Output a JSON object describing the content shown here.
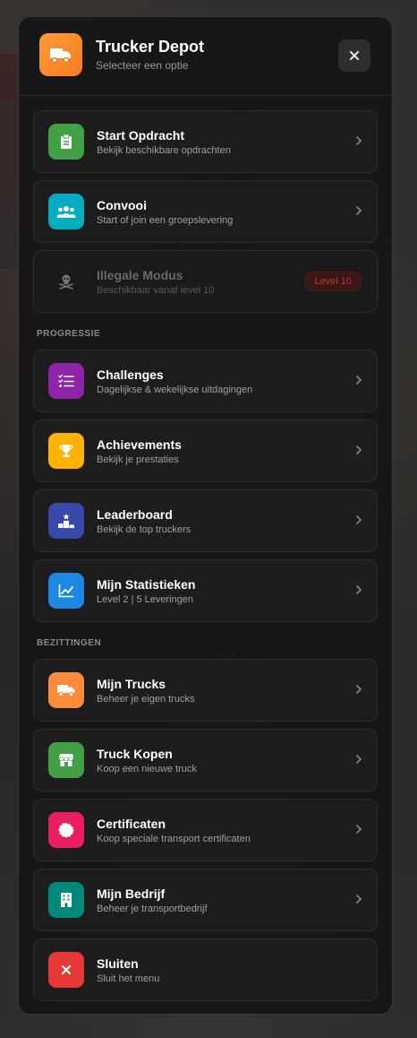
{
  "header": {
    "title": "Trucker Depot",
    "subtitle": "Selecteer een optie",
    "logo_icon": "truck-icon",
    "close_icon": "close-icon"
  },
  "items_main": [
    {
      "title": "Start Opdracht",
      "subtitle": "Bekijk beschikbare opdrachten",
      "icon": "clipboard-icon",
      "color": "#43a047"
    },
    {
      "title": "Convooi",
      "subtitle": "Start of join een groepslevering",
      "icon": "group-icon",
      "color": "#00acc1"
    },
    {
      "title": "Illegale Modus",
      "subtitle": "Beschikbaar vanaf level 10",
      "icon": "skull-icon",
      "badge": "Level 10"
    }
  ],
  "sections": {
    "progressie": "PROGRESSIE",
    "bezittingen": "BEZITTINGEN"
  },
  "items_progressie": [
    {
      "title": "Challenges",
      "subtitle": "Dagelijkse & wekelijkse uitdagingen",
      "icon": "checklist-icon",
      "color": "#8e24aa"
    },
    {
      "title": "Achievements",
      "subtitle": "Bekijk je prestaties",
      "icon": "trophy-icon",
      "color": "#ffb300"
    },
    {
      "title": "Leaderboard",
      "subtitle": "Bekijk de top truckers",
      "icon": "podium-icon",
      "color": "#3949ab"
    },
    {
      "title": "Mijn Statistieken",
      "subtitle": "Level 2 | 5 Leveringen",
      "icon": "chart-icon",
      "color": "#1e88e5"
    }
  ],
  "items_bezittingen": [
    {
      "title": "Mijn Trucks",
      "subtitle": "Beheer je eigen trucks",
      "icon": "truck-icon",
      "color": "#fb8c3c"
    },
    {
      "title": "Truck Kopen",
      "subtitle": "Koop een nieuwe truck",
      "icon": "store-icon",
      "color": "#43a047"
    },
    {
      "title": "Certificaten",
      "subtitle": "Koop speciale transport certificaten",
      "icon": "certificate-icon",
      "color": "#e91e63"
    },
    {
      "title": "Mijn Bedrijf",
      "subtitle": "Beheer je transportbedrijf",
      "icon": "building-icon",
      "color": "#00897b"
    },
    {
      "title": "Sluiten",
      "subtitle": "Sluit het menu",
      "icon": "close-icon",
      "color": "#e53935"
    }
  ]
}
